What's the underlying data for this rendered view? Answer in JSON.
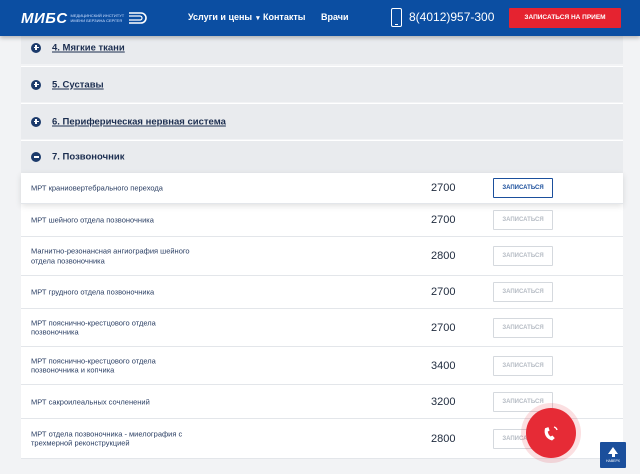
{
  "header": {
    "logo_main": "МИБС",
    "logo_sub_lines": [
      "МЕДИЦИНСКИЙ ИНСТИТУТ",
      "имени БЕРЗИНА СЕРГЕЯ"
    ],
    "nav": {
      "services": "Услуги и цены",
      "contacts": "Контакты",
      "doctors": "Врачи"
    },
    "phone": "8(4012)957-300",
    "cta": "ЗАПИСАТЬСЯ НА ПРИЕМ"
  },
  "accordion": [
    {
      "title": "4. Мягкие ткани",
      "expanded": false
    },
    {
      "title": "5. Суставы",
      "expanded": false
    },
    {
      "title": "6. Периферическая нервная система",
      "expanded": false
    },
    {
      "title": "7. Позвоночник",
      "expanded": true
    }
  ],
  "rows": [
    {
      "name": "МРТ краниовертебрального перехода",
      "price": "2700",
      "button": "ЗАПИСАТЬСЯ"
    },
    {
      "name": "МРТ шейного отдела позвоночника",
      "price": "2700",
      "button": "ЗАПИСАТЬСЯ"
    },
    {
      "name": "Магнитно-резонансная ангиография шейного отдела позвоночника",
      "price": "2800",
      "button": "ЗАПИСАТЬСЯ"
    },
    {
      "name": "МРТ грудного отдела позвоночника",
      "price": "2700",
      "button": "ЗАПИСАТЬСЯ"
    },
    {
      "name": "МРТ пояснично-крестцового отдела позвоночника",
      "price": "2700",
      "button": "ЗАПИСАТЬСЯ"
    },
    {
      "name": "МРТ пояснично-крестцового отдела позвоночника и копчика",
      "price": "3400",
      "button": "ЗАПИСАТЬСЯ"
    },
    {
      "name": "МРТ сакроилеальных сочленений",
      "price": "3200",
      "button": "ЗАПИСАТЬСЯ"
    },
    {
      "name": "МРТ отдела позвоночника - миелография с трехмерной реконструкцией",
      "price": "2800",
      "button": "ЗАПИСАТЬСЯ"
    }
  ],
  "scroll_top_label": "НАВЕРХ",
  "colors": {
    "header": "#0b4ea2",
    "cta": "#e52330",
    "accent": "#1b4f9c",
    "call_button": "#e62b36"
  },
  "icons": [
    "plus-circle-icon",
    "minus-circle-icon",
    "phone-icon",
    "handset-icon",
    "arrow-up-icon",
    "chevron-down-icon"
  ]
}
